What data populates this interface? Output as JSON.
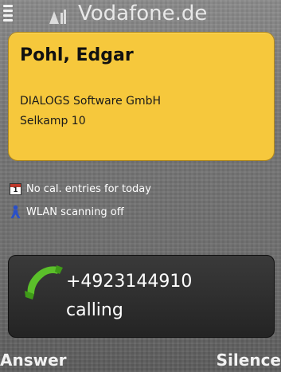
{
  "status_bar": {
    "operator": "Vodafone.de",
    "icons": [
      "menu-icon",
      "signal-icon"
    ]
  },
  "contact": {
    "name": "Pohl, Edgar",
    "company": "DIALOGS Software GmbH",
    "street": "Selkamp 10"
  },
  "info": {
    "calendar": {
      "icon": "calendar-icon",
      "text": "No cal. entries for today"
    },
    "wlan": {
      "icon": "wlan-icon",
      "text": "WLAN scanning off"
    }
  },
  "call": {
    "icon": "handset-icon",
    "number": "+4923144910",
    "status": "calling"
  },
  "softkeys": {
    "left": "Answer",
    "right": "Silence"
  },
  "colors": {
    "card": "#f6c83c",
    "panel": "#2c2c2c",
    "handset": "#5bbf2a",
    "wlan_icon": "#2a50c8",
    "text_light": "#ffffff"
  }
}
